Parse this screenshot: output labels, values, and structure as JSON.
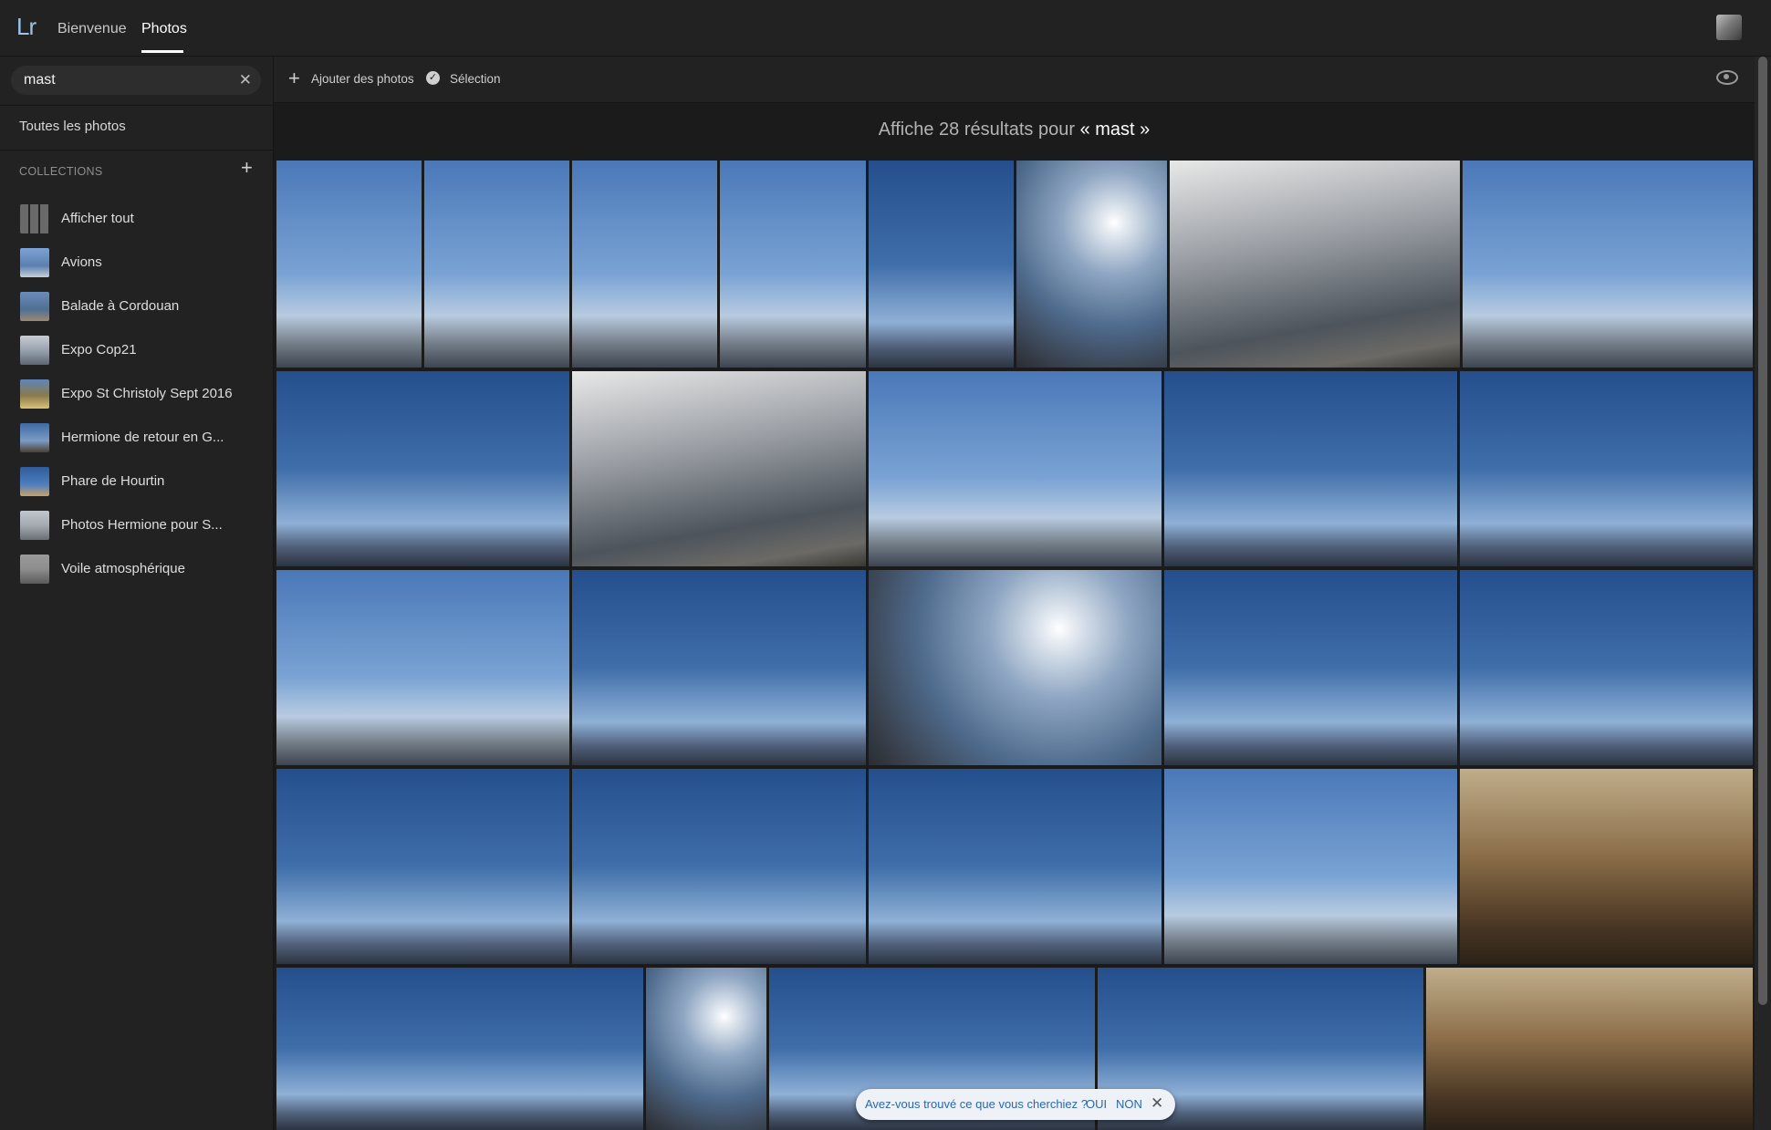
{
  "app": {
    "logo": "Lr",
    "nav": [
      {
        "label": "Bienvenue",
        "active": false
      },
      {
        "label": "Photos",
        "active": true
      }
    ],
    "accent_color": "#9ec2e6"
  },
  "search": {
    "value": "mast",
    "clear_icon": "close-icon"
  },
  "sidebar": {
    "all_photos": "Toutes les photos",
    "collections_header": "COLLECTIONS",
    "collections": [
      {
        "label": "Afficher tout",
        "thumb": "#6a6a6a"
      },
      {
        "label": "Avions",
        "thumb": "#5b7fb0"
      },
      {
        "label": "Balade à Cordouan",
        "thumb": "#4f6f93"
      },
      {
        "label": "Expo Cop21",
        "thumb": "#8d98a6"
      },
      {
        "label": "Expo St Christoly Sept 2016",
        "thumb": "#8a7a4c"
      },
      {
        "label": "Hermione de retour en G...",
        "thumb": "#3e6aa3"
      },
      {
        "label": "Phare de Hourtin",
        "thumb": "#2f5c9a"
      },
      {
        "label": "Photos Hermione pour S...",
        "thumb": "#a5aab2"
      },
      {
        "label": "Voile atmosphérique",
        "thumb": "#8d8d8d"
      }
    ]
  },
  "toolbar": {
    "add_label": "Ajouter des photos",
    "selection_label": "Sélection",
    "check_glyph": "✓",
    "plus_glyph": "+",
    "view_icon": "eye-icon"
  },
  "results": {
    "prefix": "Affiche 28 résultats pour ",
    "term": "« mast »"
  },
  "feedback": {
    "question": "Avez-vous trouvé ce que vous cherchiez ?",
    "yes": "OUI",
    "no": "NON",
    "close": "✕"
  }
}
